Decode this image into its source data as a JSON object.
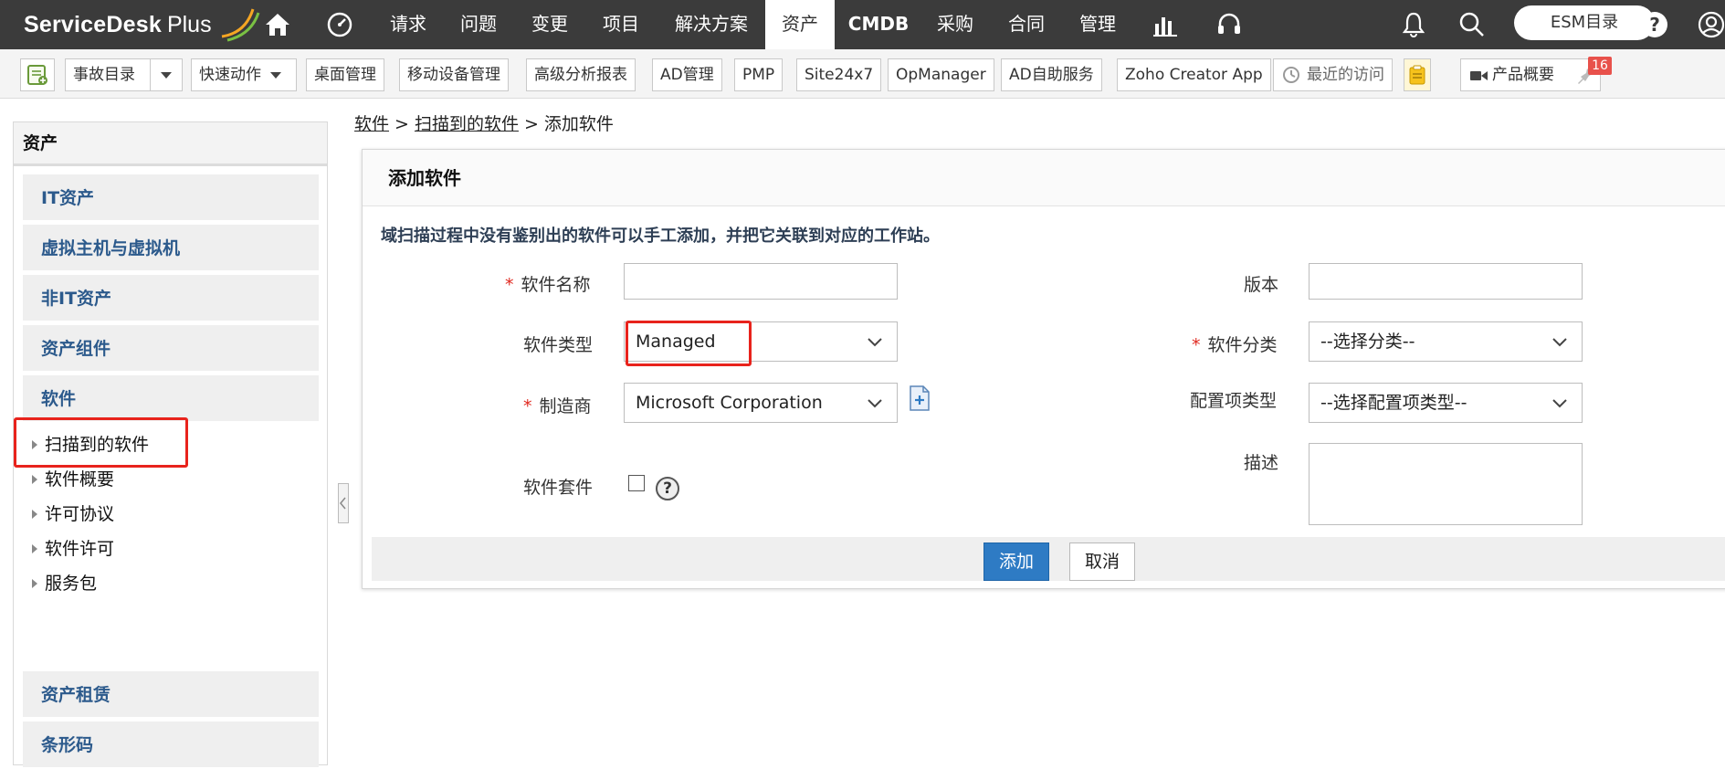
{
  "app": {
    "logo_text": "ServiceDesk",
    "logo_plus": "Plus"
  },
  "nav": {
    "items": [
      "请求",
      "问题",
      "变更",
      "项目",
      "解决方案",
      "资产",
      "CMDB",
      "采购",
      "合同",
      "管理"
    ],
    "active": "资产",
    "esm_label": "ESM目录"
  },
  "toolbar": {
    "incident_catalog": "事故目录",
    "quick_actions": "快速动作",
    "desktop_mgmt": "桌面管理",
    "mobile_mgmt": "移动设备管理",
    "analytics": "高级分析报表",
    "ad_mgmt": "AD管理",
    "pmp": "PMP",
    "site24x7": "Site24x7",
    "opmanager": "OpManager",
    "ad_selfservice": "AD自助服务",
    "zoho_creator": "Zoho Creator App",
    "recent": "最近的访问",
    "product_overview": "产品概要",
    "badge_count": "16"
  },
  "sidebar": {
    "title": "资产",
    "groups": [
      "IT资产",
      "虚拟主机与虚拟机",
      "非IT资产",
      "资产组件",
      "软件"
    ],
    "software_items": [
      "扫描到的软件",
      "软件概要",
      "许可协议",
      "软件许可",
      "服务包"
    ],
    "bottom_groups": [
      "资产租赁",
      "条形码"
    ]
  },
  "breadcrumb": {
    "level1": "软件",
    "level2": "扫描到的软件",
    "current": "添加软件",
    "separator": ">"
  },
  "form": {
    "title": "添加软件",
    "description": "域扫描过程中没有鉴别出的软件可以手工添加，并把它关联到对应的工作站。",
    "required_mark": "*",
    "software_name_label": "软件名称",
    "software_name_value": "",
    "version_label": "版本",
    "version_value": "",
    "software_type_label": "软件类型",
    "software_type_value": "Managed",
    "software_category_label": "软件分类",
    "software_category_value": "--选择分类--",
    "manufacturer_label": "制造商",
    "manufacturer_value": "Microsoft Corporation",
    "ci_type_label": "配置项类型",
    "ci_type_value": "--选择配置项类型--",
    "suite_label": "软件套件",
    "description_label": "描述",
    "help_glyph": "?",
    "add_button": "添加",
    "cancel_button": "取消"
  }
}
